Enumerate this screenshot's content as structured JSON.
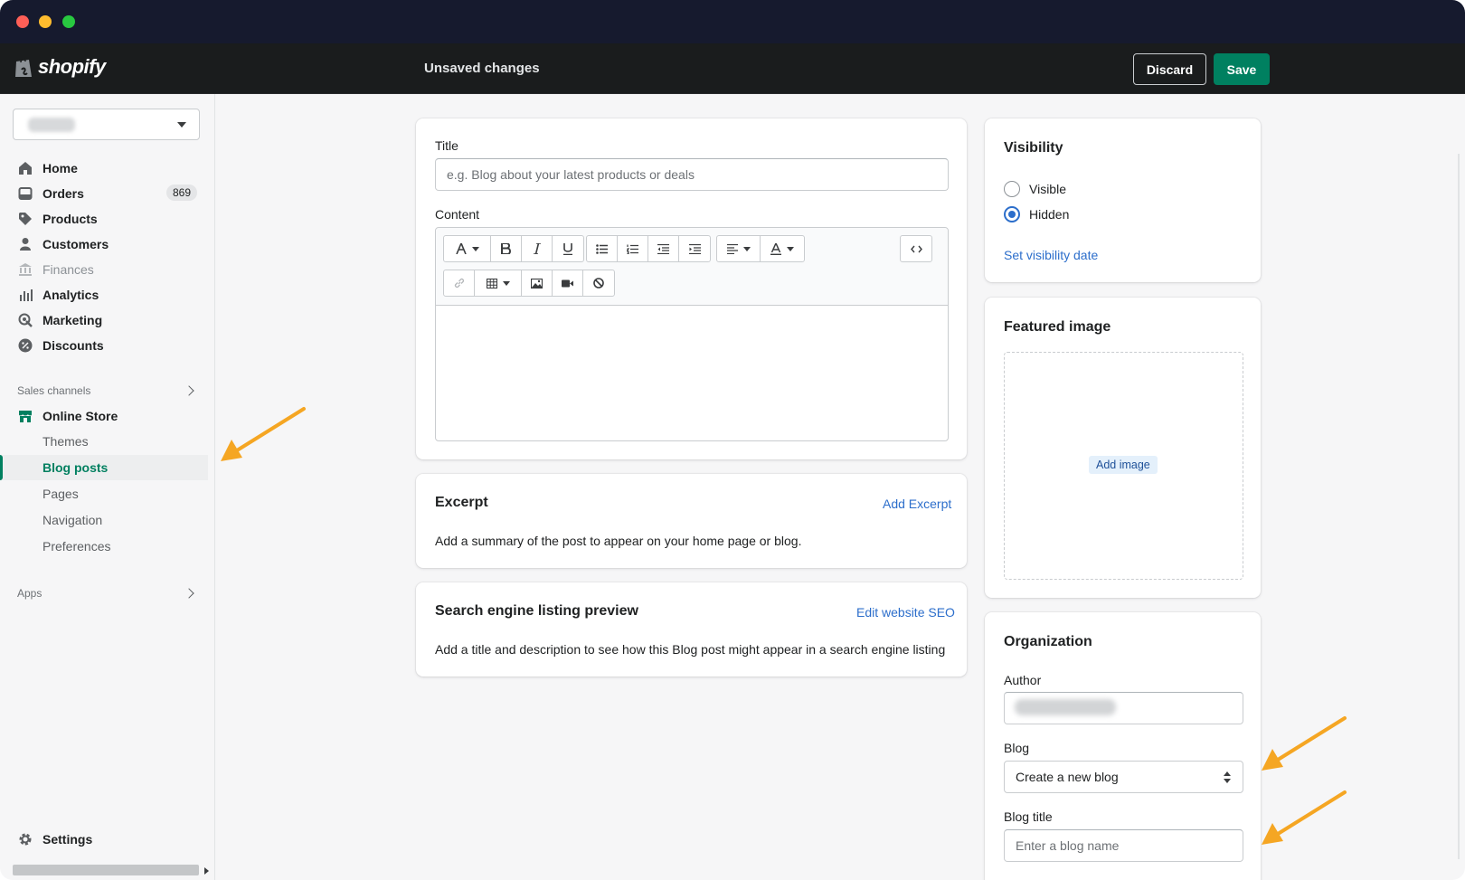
{
  "app": {
    "brand": "shopify",
    "status": "Unsaved changes",
    "discard_label": "Discard",
    "save_label": "Save",
    "accent_color": "#008060",
    "link_color": "#2c6ecb"
  },
  "sidebar": {
    "nav": [
      {
        "label": "Home",
        "icon": "home-icon"
      },
      {
        "label": "Orders",
        "icon": "orders-icon",
        "badge": "869"
      },
      {
        "label": "Products",
        "icon": "tag-icon"
      },
      {
        "label": "Customers",
        "icon": "person-icon"
      },
      {
        "label": "Finances",
        "icon": "bank-icon",
        "disabled": true
      },
      {
        "label": "Analytics",
        "icon": "bar-chart-icon"
      },
      {
        "label": "Marketing",
        "icon": "marketing-icon"
      },
      {
        "label": "Discounts",
        "icon": "discount-icon"
      }
    ],
    "sales_channels_label": "Sales channels",
    "online_store_label": "Online Store",
    "online_store_sub": [
      {
        "label": "Themes"
      },
      {
        "label": "Blog posts",
        "active": true
      },
      {
        "label": "Pages"
      },
      {
        "label": "Navigation"
      },
      {
        "label": "Preferences"
      }
    ],
    "apps_label": "Apps",
    "settings_label": "Settings"
  },
  "main": {
    "title_label": "Title",
    "title_placeholder": "e.g. Blog about your latest products or deals",
    "content_label": "Content",
    "excerpt": {
      "title": "Excerpt",
      "link": "Add Excerpt",
      "text": "Add a summary of the post to appear on your home page or blog."
    },
    "seo": {
      "title": "Search engine listing preview",
      "link": "Edit website SEO",
      "text": "Add a title and description to see how this Blog post might appear in a search engine listing"
    }
  },
  "visibility": {
    "title": "Visibility",
    "options": [
      {
        "label": "Visible",
        "checked": false
      },
      {
        "label": "Hidden",
        "checked": true
      }
    ],
    "link": "Set visibility date"
  },
  "featured_image": {
    "title": "Featured image",
    "button": "Add image"
  },
  "organization": {
    "title": "Organization",
    "author_label": "Author",
    "blog_label": "Blog",
    "blog_selected": "Create a new blog",
    "blog_title_label": "Blog title",
    "blog_title_placeholder": "Enter a blog name"
  },
  "annotations": {
    "arrow_color": "#f5a623"
  }
}
